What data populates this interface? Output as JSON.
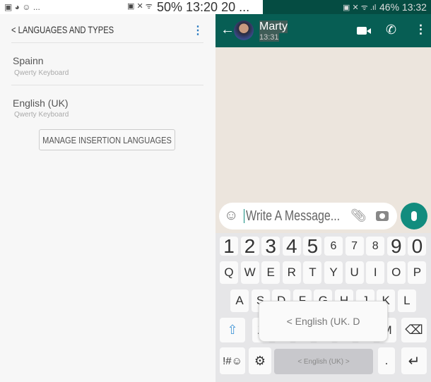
{
  "left_status": {
    "icons": "▣ ◕ ☺ ...",
    "right_icons": "▣ ✕ ᯤ",
    "battery_time": "50% 13:20 20 ..."
  },
  "settings": {
    "title": "< LANGUAGES AND TYPES",
    "languages": [
      {
        "name": "Spainn",
        "keyboard": "Qwerty Keyboard"
      },
      {
        "name": "English (UK)",
        "keyboard": "Qwerty Keyboard"
      }
    ],
    "manage_button": "MANAGE INSERTION LANGUAGES"
  },
  "right_status": {
    "icons": "▣ ✕ ᯤ .ıl",
    "battery_time": "46% 13:32"
  },
  "chat": {
    "contact_name": "Marty",
    "last_seen": "13:31",
    "input_placeholder": "Write A Message...",
    "accent": "#075e54",
    "mic_color": "#128c7e"
  },
  "keyboard": {
    "numbers": [
      "1",
      "2",
      "3",
      "4",
      "5",
      "6",
      "7",
      "8",
      "9",
      "0"
    ],
    "row1": [
      "Q",
      "W",
      "E",
      "R",
      "T",
      "Y",
      "U",
      "I",
      "O",
      "P"
    ],
    "row2": [
      "A",
      "S",
      "D",
      "F",
      "G",
      "H",
      "J",
      "K",
      "L"
    ],
    "row3": [
      "Z",
      "X",
      "C",
      "V",
      "B",
      "N",
      "M"
    ],
    "symbols_key": "!#☺",
    "space_label": "< English (UK) >",
    "period": ".",
    "popup_text": "< English (UK. D"
  }
}
